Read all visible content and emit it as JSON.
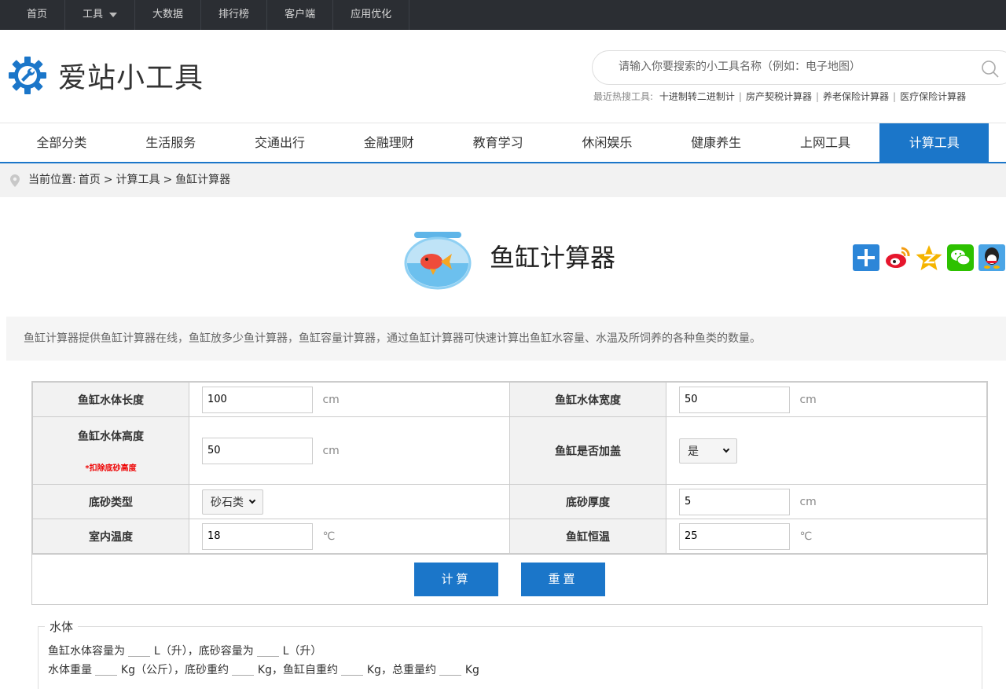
{
  "topbar": {
    "items": [
      "首页",
      "工具",
      "大数据",
      "排行榜",
      "客户端",
      "应用优化"
    ]
  },
  "header": {
    "logo_text": "爱站小工具",
    "search_placeholder": "请输入你要搜索的小工具名称（例如：电子地图）",
    "hot_label": "最近热搜工具:",
    "hot_items": [
      "十进制转二进制计",
      "房产契税计算器",
      "养老保险计算器",
      "医疗保险计算器"
    ]
  },
  "nav": {
    "items": [
      "全部分类",
      "生活服务",
      "交通出行",
      "金融理财",
      "教育学习",
      "休闲娱乐",
      "健康养生",
      "上网工具",
      "计算工具"
    ],
    "active": "计算工具"
  },
  "breadcrumb": {
    "prefix": "当前位置:",
    "home": "首页",
    "category": "计算工具",
    "current": "鱼缸计算器"
  },
  "page": {
    "title": "鱼缸计算器",
    "description": "鱼缸计算器提供鱼缸计算器在线，鱼缸放多少鱼计算器，鱼缸容量计算器，通过鱼缸计算器可快速计算出鱼缸水容量、水温及所饲养的各种鱼类的数量。"
  },
  "form": {
    "length_label": "鱼缸水体长度",
    "length_value": "100",
    "length_unit": "cm",
    "width_label": "鱼缸水体宽度",
    "width_value": "50",
    "width_unit": "cm",
    "height_label": "鱼缸水体高度",
    "height_note": "*扣除底砂高度",
    "height_value": "50",
    "height_unit": "cm",
    "cover_label": "鱼缸是否加盖",
    "cover_value": "是",
    "sand_type_label": "底砂类型",
    "sand_type_value": "砂石类",
    "sand_thick_label": "底砂厚度",
    "sand_thick_value": "5",
    "sand_thick_unit": "cm",
    "room_temp_label": "室内温度",
    "room_temp_value": "18",
    "room_temp_unit": "℃",
    "tank_temp_label": "鱼缸恒温",
    "tank_temp_value": "25",
    "tank_temp_unit": "℃",
    "calc_button": "计算",
    "reset_button": "重置"
  },
  "result": {
    "legend": "水体",
    "line1_a": "鱼缸水体容量为",
    "line1_b": "L（升），底砂容量为",
    "line1_c": "L（升）",
    "line2_a": "水体重量",
    "line2_b": "Kg（公斤），底砂重约",
    "line2_c": "Kg，鱼缸自重约",
    "line2_d": "Kg，总重量约",
    "line2_e": "Kg"
  },
  "colors": {
    "accent": "#1b76c9",
    "topbar": "#2b2e33",
    "note": "#e00000"
  }
}
